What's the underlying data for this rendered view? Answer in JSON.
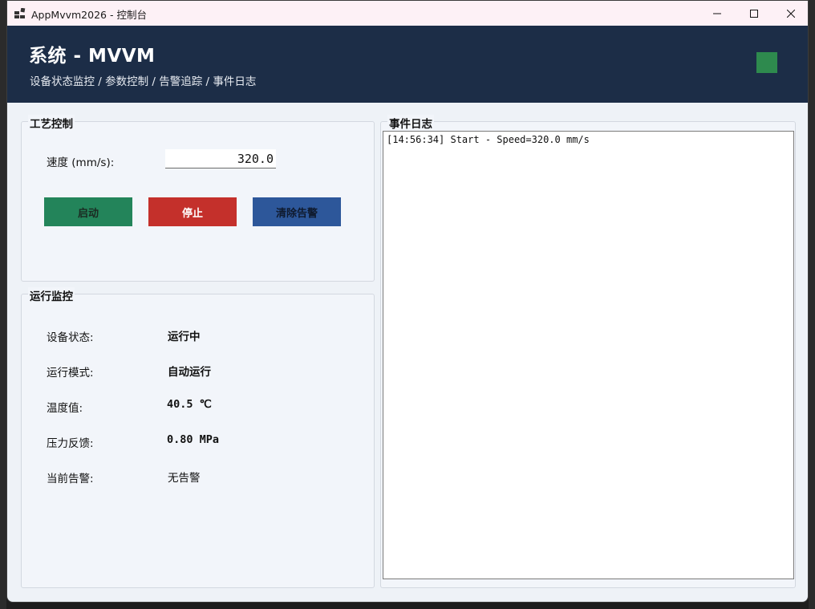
{
  "window": {
    "title": "AppMvvm2026 - 控制台"
  },
  "header": {
    "title": "系统 - MVVM",
    "subtitle": "设备状态监控 / 参数控制 / 告警追踪 / 事件日志",
    "status_color": "#2e8a4e"
  },
  "process_control": {
    "title": "工艺控制",
    "speed_label": "速度 (mm/s):",
    "speed_value": "320.0",
    "start_label": "启动",
    "stop_label": "停止",
    "clear_alarm_label": "清除告警"
  },
  "monitor": {
    "title": "运行监控",
    "device_status_label": "设备状态:",
    "device_status_value": "运行中",
    "run_mode_label": "运行模式:",
    "run_mode_value": "自动运行",
    "temperature_label": "温度值:",
    "temperature_value": "40.5 ℃",
    "pressure_label": "压力反馈:",
    "pressure_value": "0.80 MPa",
    "alarm_label": "当前告警:",
    "alarm_value": "无告警"
  },
  "event_log": {
    "title": "事件日志",
    "entries": [
      "[14:56:34] Start - Speed=320.0 mm/s"
    ]
  },
  "colors": {
    "start": "#23845a",
    "stop": "#c4302b",
    "clear": "#2d579a",
    "header_bg": "#1c2d47"
  }
}
